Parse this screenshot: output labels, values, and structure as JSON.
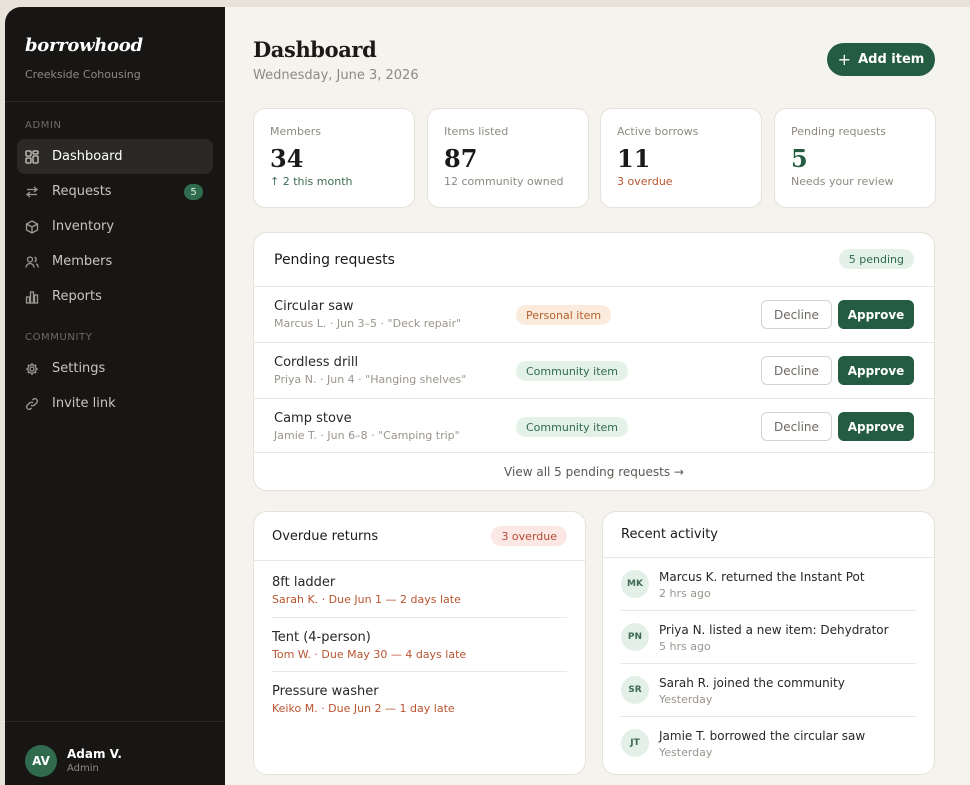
{
  "brand": {
    "name": "borrowhood",
    "community": "Creekside Cohousing"
  },
  "nav": {
    "admin_heading": "ADMIN",
    "admin_items": [
      {
        "label": "Dashboard",
        "icon": "grid-icon"
      },
      {
        "label": "Requests",
        "icon": "swap-arrows-icon",
        "badge": "5"
      },
      {
        "label": "Inventory",
        "icon": "box-icon"
      },
      {
        "label": "Members",
        "icon": "users-icon"
      },
      {
        "label": "Reports",
        "icon": "bar-chart-icon"
      }
    ],
    "community_heading": "COMMUNITY",
    "community_items": [
      {
        "label": "Settings",
        "icon": "gear-icon"
      },
      {
        "label": "Invite link",
        "icon": "link-icon"
      }
    ]
  },
  "user": {
    "initials": "AV",
    "name": "Adam V.",
    "role": "Admin"
  },
  "header": {
    "title": "Dashboard",
    "date": "Wednesday, June 3, 2026",
    "add_label": "Add item",
    "add_icon": "plus"
  },
  "stats": [
    {
      "label": "Members",
      "value": "34",
      "sub": "↑ 2 this month"
    },
    {
      "label": "Items listed",
      "value": "87",
      "sub": "12 community owned"
    },
    {
      "label": "Active borrows",
      "value": "11",
      "sub": "3 overdue"
    },
    {
      "label": "Pending requests",
      "value": "5",
      "sub": "Needs your review"
    }
  ],
  "pending": {
    "title": "Pending requests",
    "badge": "5 pending",
    "decline_label": "Decline",
    "approve_label": "Approve",
    "rows": [
      {
        "item": "Circular saw",
        "meta": "Marcus L. · Jun 3–5 · \"Deck repair\"",
        "type": "Personal item"
      },
      {
        "item": "Cordless drill",
        "meta": "Priya N. · Jun 4 · \"Hanging shelves\"",
        "type": "Community item"
      },
      {
        "item": "Camp stove",
        "meta": "Jamie T. · Jun 6–8 · \"Camping trip\"",
        "type": "Community item"
      }
    ],
    "view_all": "View all 5 pending requests →"
  },
  "overdue": {
    "title": "Overdue returns",
    "badge": "3 overdue",
    "rows": [
      {
        "item": "8ft ladder",
        "meta": "Sarah K. · Due Jun 1 — 2 days late"
      },
      {
        "item": "Tent (4-person)",
        "meta": "Tom W. · Due May 30 — 4 days late"
      },
      {
        "item": "Pressure washer",
        "meta": "Keiko M. · Due Jun 2 — 1 day late"
      }
    ]
  },
  "activity": {
    "title": "Recent activity",
    "rows": [
      {
        "initials": "MK",
        "text": "Marcus K. returned the Instant Pot",
        "time": "2 hrs ago"
      },
      {
        "initials": "PN",
        "text": "Priya N. listed a new item: Dehydrator",
        "time": "5 hrs ago"
      },
      {
        "initials": "SR",
        "text": "Sarah R. joined the community",
        "time": "Yesterday"
      },
      {
        "initials": "JT",
        "text": "Jamie T. borrowed the circular saw",
        "time": "Yesterday"
      }
    ]
  },
  "colors": {
    "brand_green": "#245c42",
    "sidebar_bg": "#171614",
    "page_bg": "#f5f3ee",
    "overdue_red": "#b8542f"
  }
}
